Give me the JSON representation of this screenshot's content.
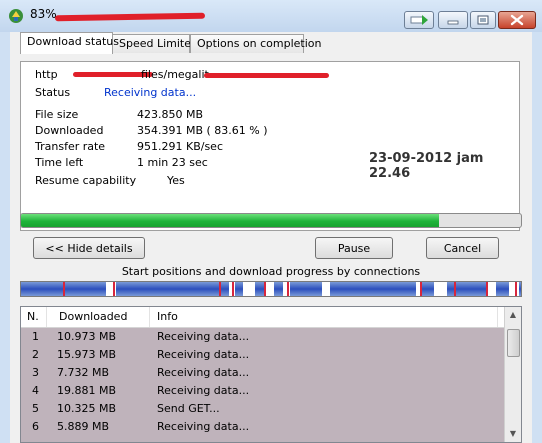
{
  "window": {
    "title": "83%"
  },
  "tabs": [
    {
      "label": "Download status"
    },
    {
      "label": "Speed Limiter"
    },
    {
      "label": "Options on completion"
    }
  ],
  "status": {
    "url_prefix": "http",
    "url_middle": "files/megalit",
    "status_label": "Status",
    "status_value": "Receiving data...",
    "file_size_label": "File size",
    "file_size_value": "423.850  MB",
    "downloaded_label": "Downloaded",
    "downloaded_value": "354.391  MB  ( 83.61 % )",
    "transfer_rate_label": "Transfer rate",
    "transfer_rate_value": "951.291  KB/sec",
    "time_left_label": "Time left",
    "time_left_value": "1 min 23 sec",
    "resume_label": "Resume capability",
    "resume_value": "Yes",
    "status_color": "#0033cc"
  },
  "overlay_text": "23-09-2012 jam 22.46",
  "progress": {
    "fraction": 0.8361,
    "color": "#1fb43a"
  },
  "buttons": {
    "hide_details": "<< Hide details",
    "pause": "Pause",
    "cancel": "Cancel"
  },
  "connections_label": "Start positions and download progress by connections",
  "connections_list": {
    "headers": [
      "N.",
      "Downloaded",
      "Info"
    ],
    "rows": [
      {
        "n": "1",
        "downloaded": "10.973  MB",
        "info": "Receiving data..."
      },
      {
        "n": "2",
        "downloaded": "15.973  MB",
        "info": "Receiving data..."
      },
      {
        "n": "3",
        "downloaded": "7.732  MB",
        "info": "Receiving data..."
      },
      {
        "n": "4",
        "downloaded": "19.881  MB",
        "info": "Receiving data..."
      },
      {
        "n": "5",
        "downloaded": "10.325  MB",
        "info": "Send GET..."
      },
      {
        "n": "6",
        "downloaded": "5.889  MB",
        "info": "Receiving data..."
      }
    ]
  }
}
